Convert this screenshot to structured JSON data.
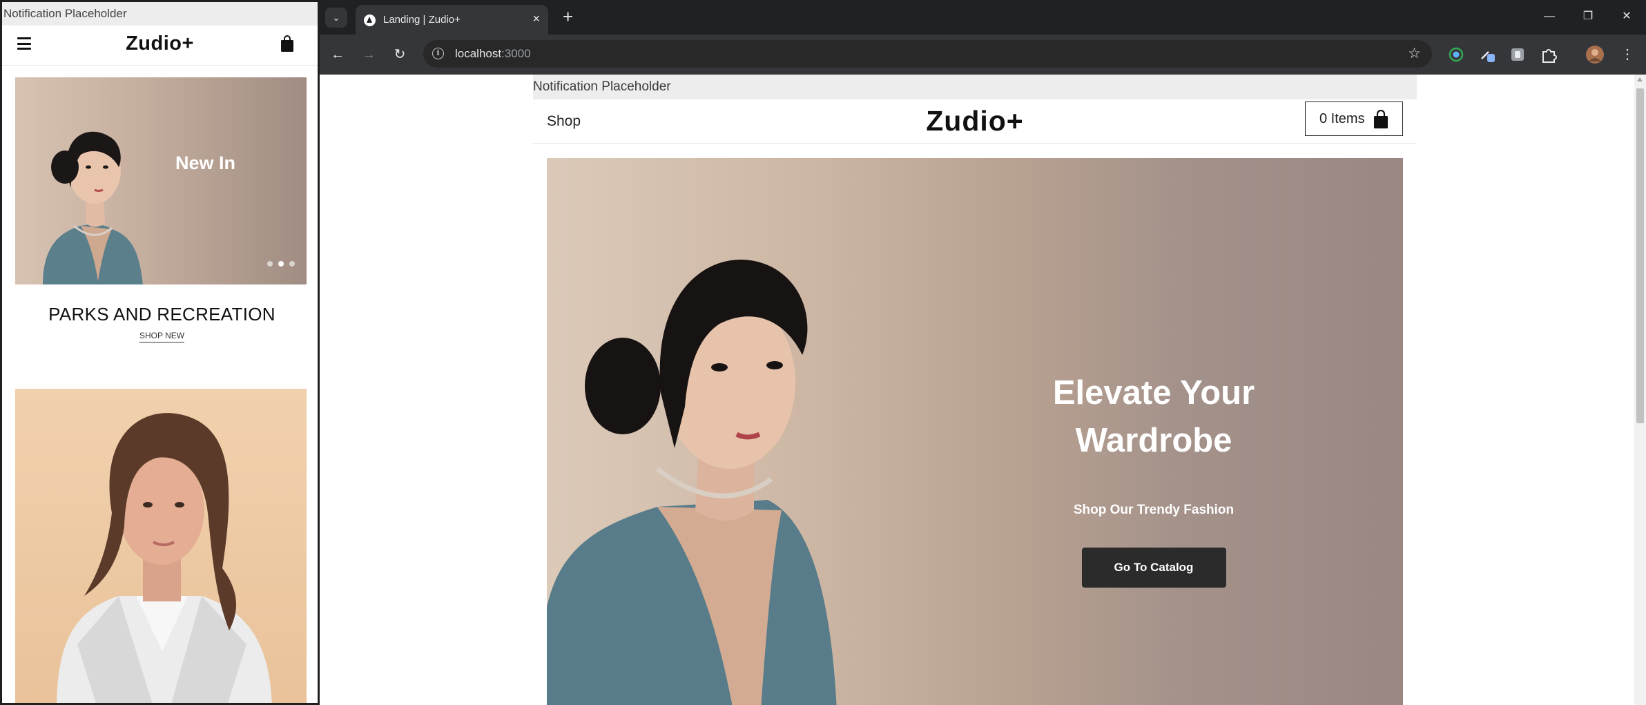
{
  "mobile": {
    "notification": "Notification Placeholder",
    "logo": "Zudio+",
    "slide_title": "New In",
    "section_title": "PARKS AND RECREATION",
    "shop_link": "SHOP NEW"
  },
  "browser": {
    "tab_title": "Landing | Zudio+",
    "url_host": "localhost",
    "url_port": ":3000"
  },
  "site": {
    "notification": "Notification Placeholder",
    "nav_shop": "Shop",
    "logo": "Zudio+",
    "cart_label": "0 Items",
    "hero": {
      "title": "Elevate Your Wardrobe",
      "subtitle": "Shop Our Trendy Fashion",
      "cta": "Go To Catalog"
    }
  },
  "colors": {
    "browser_frame": "#202124",
    "toolbar": "#35363a",
    "cta_background": "#2b2b2b",
    "hero_gradient_start": "#dccab9",
    "hero_gradient_end": "#9a8782"
  },
  "icons": [
    "menu-icon",
    "shopping-bag-icon",
    "back-icon",
    "forward-icon",
    "reload-icon",
    "site-info-icon",
    "bookmark-star-icon",
    "extensions-icon",
    "kebab-menu-icon",
    "minimize-icon",
    "restore-icon",
    "close-icon"
  ]
}
